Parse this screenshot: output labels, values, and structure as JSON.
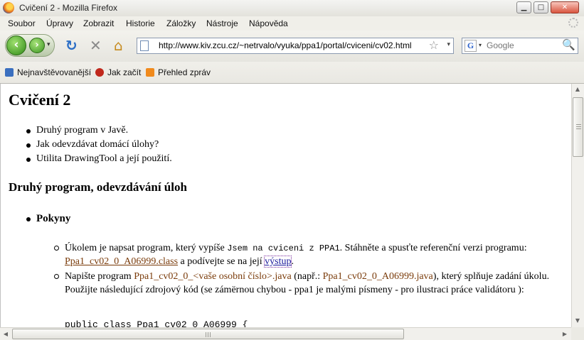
{
  "window": {
    "title": "Cvičení 2 - Mozilla Firefox",
    "minimize_glyph": "▁",
    "maximize_glyph": "□",
    "close_glyph": "✕"
  },
  "menu": {
    "items": [
      "Soubor",
      "Úpravy",
      "Zobrazit",
      "Historie",
      "Záložky",
      "Nástroje",
      "Nápověda"
    ]
  },
  "navbar": {
    "back_glyph": "‹",
    "forward_glyph": "›",
    "dropdown_glyph": "▾",
    "reload_glyph": "↻",
    "stop_glyph": "✕",
    "home_glyph": "⌂",
    "url": "http://www.kiv.zcu.cz/~netrvalo/vyuka/ppa1/portal/cviceni/cv02.html",
    "star_glyph": "☆",
    "search_engine_glyph": "G",
    "search_placeholder": "Google",
    "search_go_glyph": "🔍"
  },
  "bookmarks": {
    "items": [
      "Nejnavštěvovanější",
      "Jak začít",
      "Přehled zpráv"
    ]
  },
  "page": {
    "heading": "Cvičení 2",
    "topics": [
      "Druhý program v Javě.",
      "Jak odevzdávat domácí úlohy?",
      "Utilita DrawingTool a její použití."
    ],
    "section_heading": "Druhý program, odevzdávání úloh",
    "pokyny": "Pokyny",
    "item1": {
      "t1": "Úkolem je napsat program, který vypíše ",
      "code": "Jsem na cviceni z PPA1",
      "t2": ". Stáhněte a spusťte referenční verzi programu: ",
      "link1": "Ppa1_cv02_0_A06999.class",
      "t3": " a podívejte se na její ",
      "link2": "výstup",
      "t4": "."
    },
    "item2": {
      "t1": "Napište program ",
      "name": "Ppa1_cv02_0_<vaše osobní číslo>.java",
      "t2": " (např.: ",
      "example": "Ppa1_cv02_0_A06999.java",
      "t3": "), který splňuje zadání úkolu. Použijte následující zdrojový kód (se zámërnou chybou - ppa1 je malými písmeny - pro ilustraci práce validátoru ):"
    },
    "code_line": "public class Ppa1_cv02_0_A06999 {"
  },
  "scrollbars": {
    "up_glyph": "▲",
    "down_glyph": "▼",
    "left_glyph": "◀",
    "right_glyph": "▶"
  }
}
